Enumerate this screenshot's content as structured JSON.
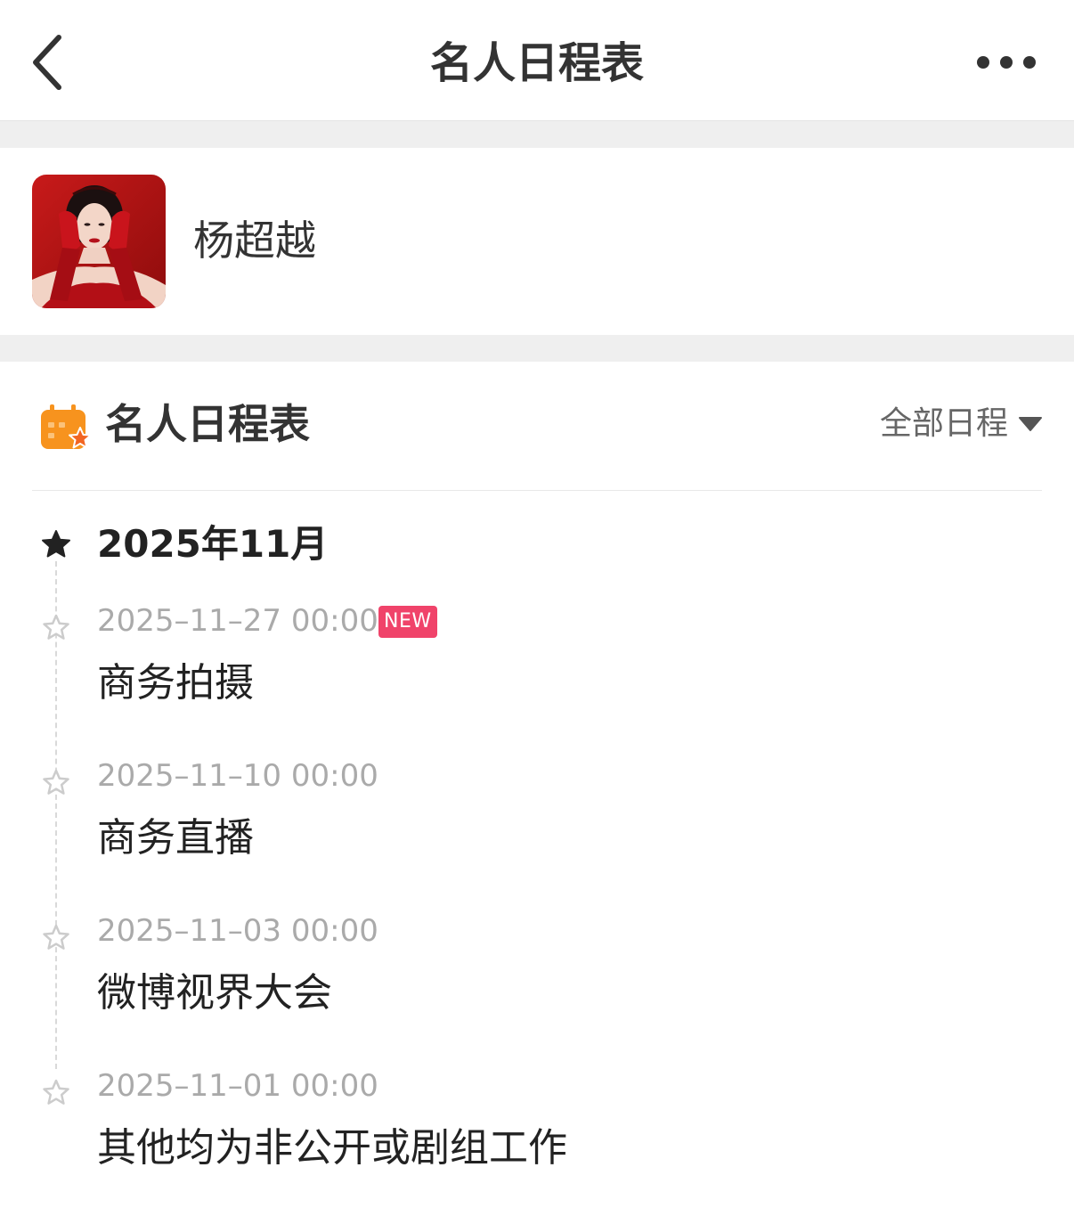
{
  "nav": {
    "title": "名人日程表"
  },
  "profile": {
    "name": "杨超越"
  },
  "schedule": {
    "title": "名人日程表",
    "filter_label": "全部日程",
    "month": "2025年11月",
    "events": [
      {
        "time": "2025–11–27 00:00",
        "badge": "NEW",
        "title": "商务拍摄"
      },
      {
        "time": "2025–11–10 00:00",
        "title": "商务直播"
      },
      {
        "time": "2025–11–03 00:00",
        "title": "微博视界大会"
      },
      {
        "time": "2025–11–01 00:00",
        "title": "其他均为非公开或剧组工作"
      }
    ]
  },
  "icons": {
    "back": "chevron-left-icon",
    "more": "more-horizontal-icon",
    "schedule": "calendar-star-icon",
    "filter": "caret-down-icon",
    "month_marker": "filled-star-icon",
    "event_marker": "outline-star-icon"
  },
  "colors": {
    "accent_orange": "#f7931e",
    "badge_pink": "#f0436a",
    "separator": "#efefef",
    "muted_text": "#aaaaaa"
  }
}
